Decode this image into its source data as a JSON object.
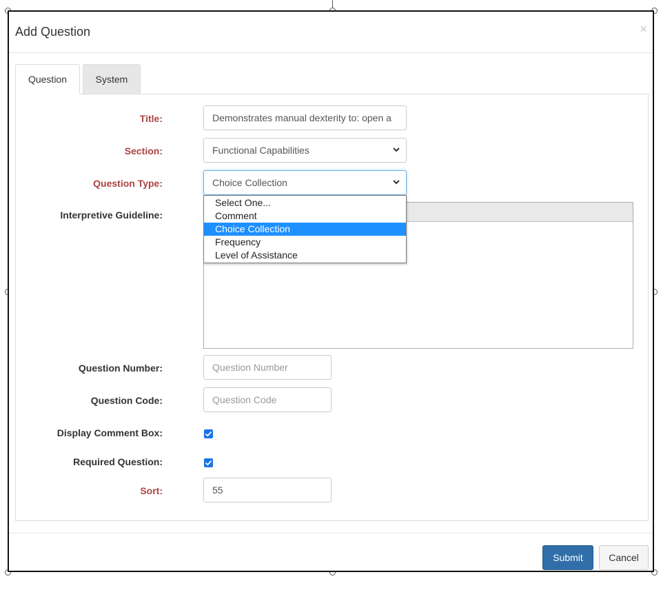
{
  "dialog": {
    "title": "Add Question",
    "close_label": "×"
  },
  "tabs": [
    {
      "label": "Question",
      "active": true
    },
    {
      "label": "System",
      "active": false
    }
  ],
  "form": {
    "title": {
      "label": "Title:",
      "value": "Demonstrates manual dexterity to: open a"
    },
    "section": {
      "label": "Section:",
      "value": "Functional Capabilities"
    },
    "question_type": {
      "label": "Question Type:",
      "value": "Choice Collection",
      "options": [
        "Select One...",
        "Comment",
        "Choice Collection",
        "Frequency",
        "Level of Assistance"
      ],
      "selected_option": "Choice Collection"
    },
    "interpretive_guideline": {
      "label": "Interpretive Guideline:",
      "value": ""
    },
    "question_number": {
      "label": "Question Number:",
      "placeholder": "Question Number"
    },
    "question_code": {
      "label": "Question Code:",
      "placeholder": "Question Code"
    },
    "display_comment_box": {
      "label": "Display Comment Box:",
      "checked": true
    },
    "required_question": {
      "label": "Required Question:",
      "checked": true
    },
    "sort": {
      "label": "Sort:",
      "value": "55"
    }
  },
  "footer": {
    "submit_label": "Submit",
    "cancel_label": "Cancel"
  },
  "colors": {
    "required_label": "#a94442",
    "submit_button": "#2f6ea8",
    "selected_option": "#1e90ff",
    "checkbox": "#1a73e8"
  },
  "icons": {
    "select_arrow": "chevron-down-icon",
    "checkbox_check": "check-icon",
    "close": "close-icon"
  }
}
